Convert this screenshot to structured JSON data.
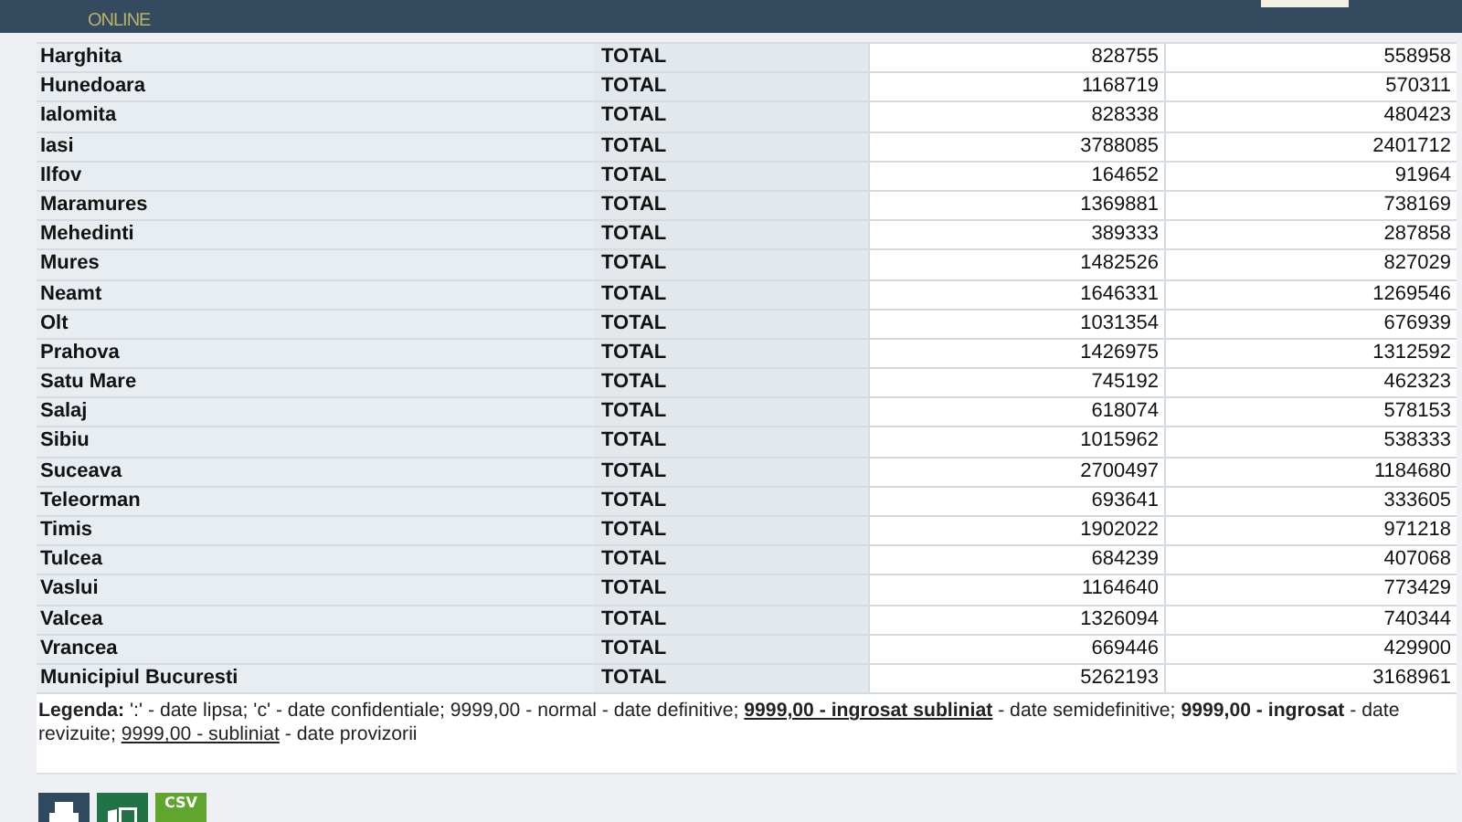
{
  "header": {
    "logo_text": "ONLINE"
  },
  "table": {
    "rows": [
      {
        "name": "Harghita",
        "total": "TOTAL",
        "value_1": "828755",
        "value_2": "558958"
      },
      {
        "name": "Hunedoara",
        "total": "TOTAL",
        "value_1": "1168719",
        "value_2": "570311"
      },
      {
        "name": "Ialomita",
        "total": "TOTAL",
        "value_1": "828338",
        "value_2": "480423"
      },
      {
        "name": "Iasi",
        "total": "TOTAL",
        "value_1": "3788085",
        "value_2": "2401712"
      },
      {
        "name": "Ilfov",
        "total": "TOTAL",
        "value_1": "164652",
        "value_2": "91964"
      },
      {
        "name": "Maramures",
        "total": "TOTAL",
        "value_1": "1369881",
        "value_2": "738169"
      },
      {
        "name": "Mehedinti",
        "total": "TOTAL",
        "value_1": "389333",
        "value_2": "287858"
      },
      {
        "name": "Mures",
        "total": "TOTAL",
        "value_1": "1482526",
        "value_2": "827029"
      },
      {
        "name": "Neamt",
        "total": "TOTAL",
        "value_1": "1646331",
        "value_2": "1269546"
      },
      {
        "name": "Olt",
        "total": "TOTAL",
        "value_1": "1031354",
        "value_2": "676939"
      },
      {
        "name": "Prahova",
        "total": "TOTAL",
        "value_1": "1426975",
        "value_2": "1312592"
      },
      {
        "name": "Satu Mare",
        "total": "TOTAL",
        "value_1": "745192",
        "value_2": "462323"
      },
      {
        "name": "Salaj",
        "total": "TOTAL",
        "value_1": "618074",
        "value_2": "578153"
      },
      {
        "name": "Sibiu",
        "total": "TOTAL",
        "value_1": "1015962",
        "value_2": "538333"
      },
      {
        "name": "Suceava",
        "total": "TOTAL",
        "value_1": "2700497",
        "value_2": "1184680"
      },
      {
        "name": "Teleorman",
        "total": "TOTAL",
        "value_1": "693641",
        "value_2": "333605"
      },
      {
        "name": "Timis",
        "total": "TOTAL",
        "value_1": "1902022",
        "value_2": "971218"
      },
      {
        "name": "Tulcea",
        "total": "TOTAL",
        "value_1": "684239",
        "value_2": "407068"
      },
      {
        "name": "Vaslui",
        "total": "TOTAL",
        "value_1": "1164640",
        "value_2": "773429"
      },
      {
        "name": "Valcea",
        "total": "TOTAL",
        "value_1": "1326094",
        "value_2": "740344"
      },
      {
        "name": "Vrancea",
        "total": "TOTAL",
        "value_1": "669446",
        "value_2": "429900"
      },
      {
        "name": "Municipiul Bucuresti",
        "total": "TOTAL",
        "value_1": "5262193",
        "value_2": "3168961"
      }
    ]
  },
  "legend": {
    "segments": [
      {
        "kind": "bold",
        "text": "Legenda:"
      },
      {
        "kind": "plain",
        "text": " ':' - date lipsa; 'c' - date confidentiale; 9999,00 - normal - date definitive; "
      },
      {
        "kind": "bold-underline",
        "text": "9999,00 - ingrosat subliniat"
      },
      {
        "kind": "plain",
        "text": " - date semidefinitive; "
      },
      {
        "kind": "bold",
        "text": "9999,00 - ingrosat"
      },
      {
        "kind": "plain",
        "text": " - date revizuite; "
      },
      {
        "kind": "underline",
        "text": "9999,00 - subliniat"
      },
      {
        "kind": "plain",
        "text": " - date provizorii"
      }
    ]
  },
  "export": {
    "csv_label": "CSV"
  }
}
